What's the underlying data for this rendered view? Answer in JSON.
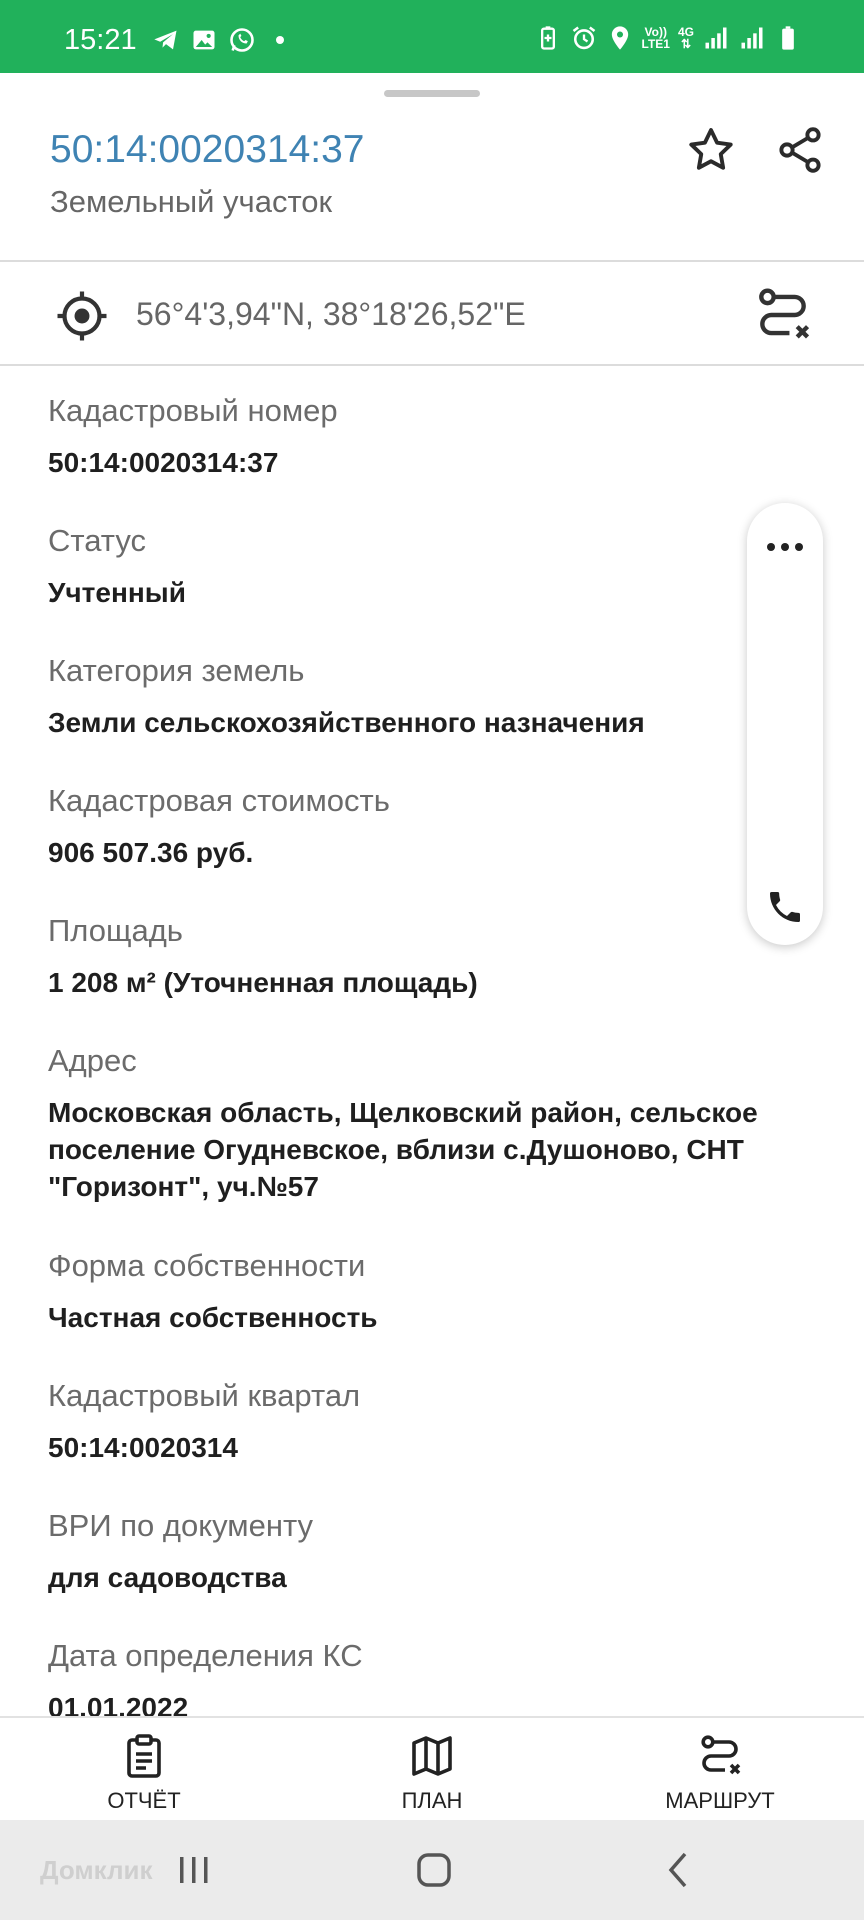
{
  "status_bar": {
    "time": "15:21",
    "left_icons": [
      "telegram-icon",
      "gallery-icon",
      "whatsapp-icon",
      "notification-dot"
    ],
    "right_icons": [
      "battery-saver-icon",
      "alarm-icon",
      "location-icon",
      "volte-icon",
      "4g-icon",
      "signal-icon",
      "signal-icon",
      "battery-icon"
    ],
    "network_labels": {
      "volte_top": "Vo))",
      "volte_bottom": "LTE1",
      "net_type": "4G"
    },
    "background_color": "#21b15b"
  },
  "header": {
    "title": "50:14:0020314:37",
    "subtitle": "Земельный участок",
    "title_color": "#3f83b3"
  },
  "coordinates": {
    "text": "56°4'3,94\"N, 38°18'26,52\"E"
  },
  "info": {
    "items": [
      {
        "label": "Кадастровый номер",
        "value": "50:14:0020314:37"
      },
      {
        "label": "Статус",
        "value": "Учтенный"
      },
      {
        "label": "Категория земель",
        "value": "Земли сельскохозяйственного назначения"
      },
      {
        "label": "Кадастровая стоимость",
        "value": "906 507.36 руб."
      },
      {
        "label": "Площадь",
        "value": "1 208 м² (Уточненная площадь)"
      },
      {
        "label": "Адрес",
        "value": "Московская область, Щелковский район, сельское поселение Огудневское, вблизи с.Душоново, СНТ \"Горизонт\", уч.№57"
      },
      {
        "label": "Форма собственности",
        "value": "Частная собственность"
      },
      {
        "label": "Кадастровый квартал",
        "value": "50:14:0020314"
      },
      {
        "label": "ВРИ по документу",
        "value": "для садоводства"
      },
      {
        "label": "Дата определения КС",
        "value": "01.01.2022"
      }
    ]
  },
  "bottom_nav": {
    "items": [
      {
        "label": "ОТЧЁТ",
        "icon": "clipboard-icon"
      },
      {
        "label": "ПЛАН",
        "icon": "map-icon"
      },
      {
        "label": "МАРШРУТ",
        "icon": "route-icon"
      }
    ]
  },
  "watermark": "Домклик"
}
